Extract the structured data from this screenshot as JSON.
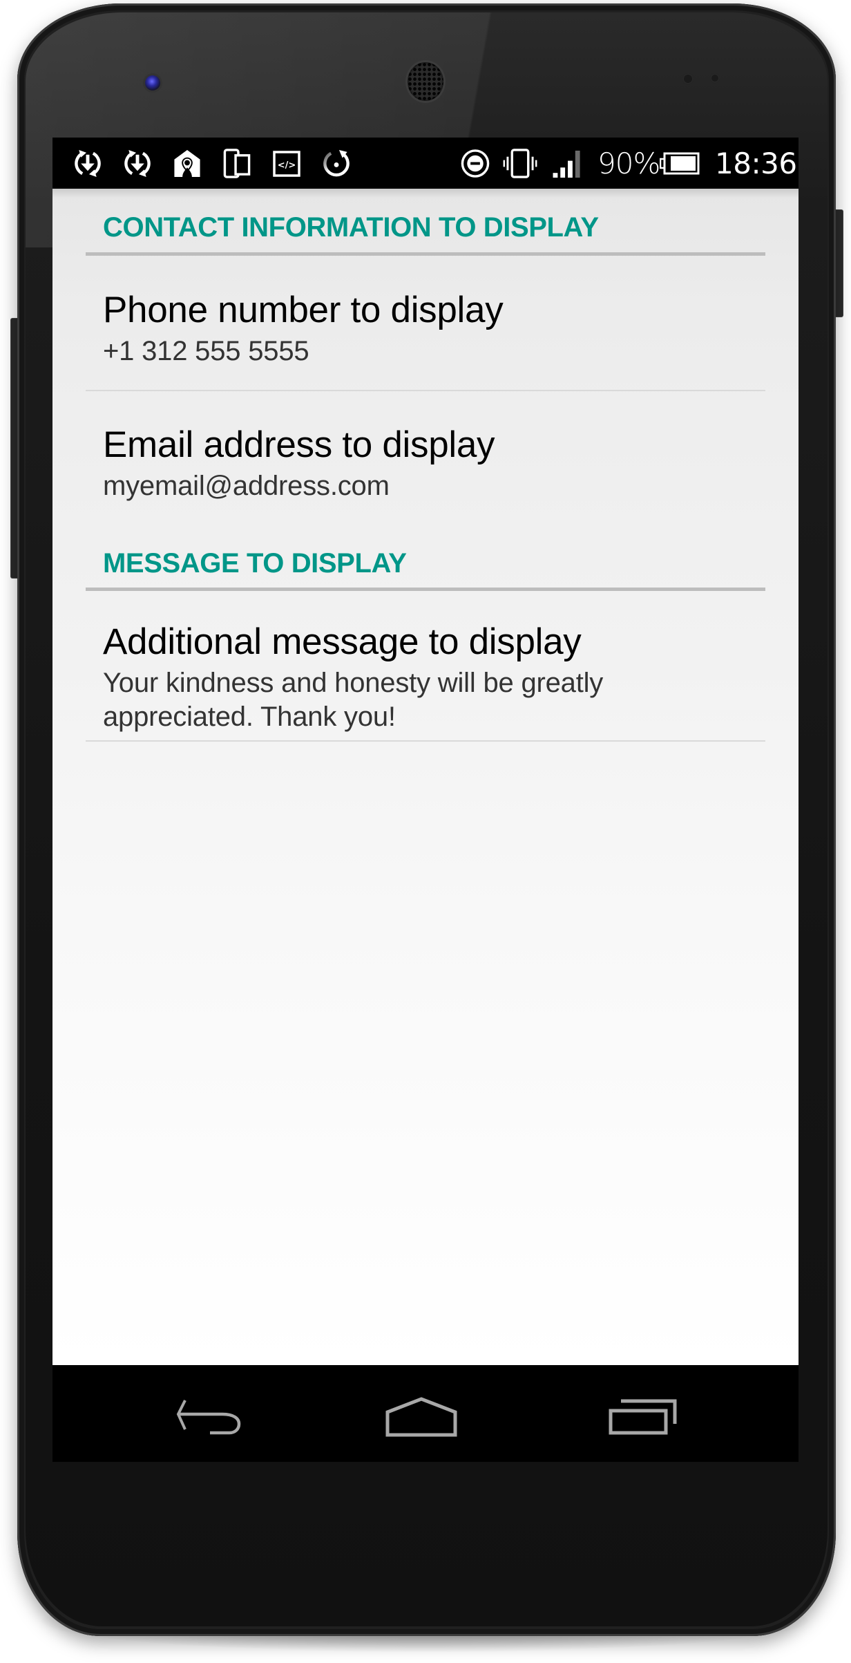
{
  "device": {
    "model": "Android phone frame",
    "hardware": [
      "front-camera",
      "earpiece",
      "proximity-sensor",
      "volume-button",
      "power-button"
    ]
  },
  "status_bar": {
    "left_icons": [
      {
        "name": "sync-download-icon"
      },
      {
        "name": "sync-download-icon"
      },
      {
        "name": "home-location-icon"
      },
      {
        "name": "devices-icon"
      },
      {
        "name": "developer-code-icon"
      },
      {
        "name": "refresh-circle-icon"
      }
    ],
    "right_icons": [
      {
        "name": "do-not-disturb-icon"
      },
      {
        "name": "vibrate-icon"
      },
      {
        "name": "signal-strength-icon"
      }
    ],
    "battery_percent": "90%",
    "battery_level": 0.9,
    "signal_bars": 3,
    "signal_bars_total": 4,
    "time": "18:36"
  },
  "preferences": {
    "categories": [
      {
        "title": "CONTACT INFORMATION TO DISPLAY",
        "items": [
          {
            "title": "Phone number to display",
            "summary": "+1 312 555 5555"
          },
          {
            "title": "Email address to display",
            "summary": "myemail@address.com"
          }
        ]
      },
      {
        "title": "MESSAGE TO DISPLAY",
        "items": [
          {
            "title": "Additional message to display",
            "summary": "Your kindness and honesty will be greatly\nappreciated. Thank you!"
          }
        ]
      }
    ]
  },
  "nav_bar": {
    "buttons": [
      {
        "name": "back"
      },
      {
        "name": "home"
      },
      {
        "name": "recent-apps"
      }
    ]
  },
  "colors": {
    "accent": "#009688",
    "divider": "#bdbdbd",
    "title_text": "#000000",
    "summary_text": "#333333",
    "nav_icon": "#a8a8a8"
  }
}
